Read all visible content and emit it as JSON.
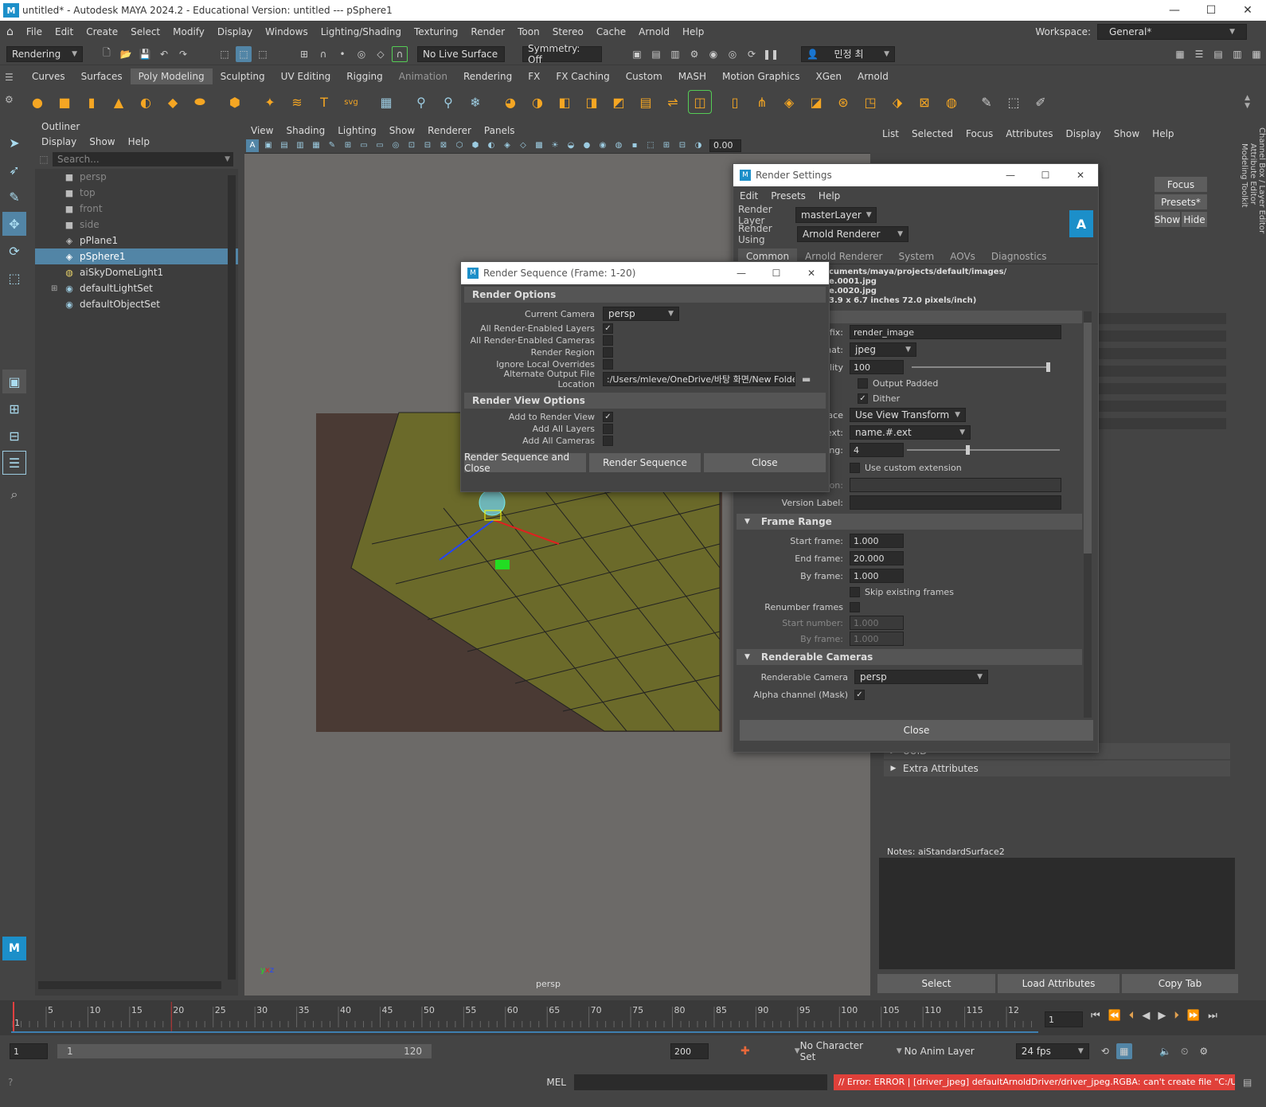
{
  "window": {
    "title": "untitled* - Autodesk MAYA 2024.2 - Educational Version: untitled   ---   pSphere1",
    "minimize": "—",
    "maximize": "☐",
    "close": "✕"
  },
  "menubar": {
    "items": [
      "File",
      "Edit",
      "Create",
      "Select",
      "Modify",
      "Display",
      "Windows",
      "Lighting/Shading",
      "Texturing",
      "Render",
      "Toon",
      "Stereo",
      "Cache",
      "Arnold",
      "Help"
    ],
    "workspace_label": "Workspace:",
    "workspace_value": "General*"
  },
  "statusline": {
    "menuset": "Rendering",
    "live_surface": "No Live Surface",
    "symmetry": "Symmetry: Off",
    "user": "민정 최"
  },
  "shelf": {
    "tabs": [
      "Curves",
      "Surfaces",
      "Poly Modeling",
      "Sculpting",
      "UV Editing",
      "Rigging",
      "Animation",
      "Rendering",
      "FX",
      "FX Caching",
      "Custom",
      "MASH",
      "Motion Graphics",
      "XGen",
      "Arnold"
    ],
    "active_tab": "Poly Modeling"
  },
  "outliner": {
    "title": "Outliner",
    "menu": [
      "Display",
      "Show",
      "Help"
    ],
    "search_placeholder": "Search...",
    "items": [
      {
        "label": "persp",
        "icon": "camera-icon",
        "state": "dim"
      },
      {
        "label": "top",
        "icon": "camera-icon",
        "state": "dim"
      },
      {
        "label": "front",
        "icon": "camera-icon",
        "state": "dim"
      },
      {
        "label": "side",
        "icon": "camera-icon",
        "state": "dim"
      },
      {
        "label": "pPlane1",
        "icon": "mesh-icon",
        "state": "normal"
      },
      {
        "label": "pSphere1",
        "icon": "mesh-icon",
        "state": "selected"
      },
      {
        "label": "aiSkyDomeLight1",
        "icon": "light-icon",
        "state": "normal"
      },
      {
        "label": "defaultLightSet",
        "icon": "set-icon",
        "state": "normal"
      },
      {
        "label": "defaultObjectSet",
        "icon": "set-icon",
        "state": "normal"
      }
    ]
  },
  "viewport": {
    "menu": [
      "View",
      "Shading",
      "Lighting",
      "Show",
      "Renderer",
      "Panels"
    ],
    "camera_label": "persp",
    "exposure": "0.00"
  },
  "attribute_editor": {
    "menu": [
      "List",
      "Selected",
      "Focus",
      "Attributes",
      "Display",
      "Show",
      "Help"
    ],
    "focus_button": "Focus",
    "presets_button": "Presets*",
    "show_button": "Show",
    "hide_button": "Hide",
    "uuid_section": "UUID",
    "extra_section": "Extra Attributes",
    "notes_label": "Notes:  aiStandardSurface2",
    "select_button": "Select",
    "load_button": "Load Attributes",
    "copy_button": "Copy Tab"
  },
  "render_settings": {
    "title": "Render Settings",
    "menu": [
      "Edit",
      "Presets",
      "Help"
    ],
    "render_layer_label": "Render Layer",
    "render_layer_value": "masterLayer",
    "render_using_label": "Render Using",
    "render_using_value": "Arnold Renderer",
    "tabs": [
      "Common",
      "Arnold Renderer",
      "System",
      "AOVs",
      "Diagnostics"
    ],
    "path_line1": "cuments/maya/projects/default/images/",
    "path_line2": "e.0001.jpg",
    "path_line3": "e.0020.jpg",
    "path_line4": "3.9 x 6.7 inches 72.0 pixels/inch)",
    "prefix_label": "prefix:",
    "prefix_value": "render_image",
    "format_label": "format:",
    "format_value": "jpeg",
    "quality_label": "Quality",
    "quality_value": "100",
    "output_padded": "Output Padded",
    "dither": "Dither",
    "space_label": "Space",
    "space_value": "Use View Transform",
    "ext_label": "on ext:",
    "ext_value": "name.#.ext",
    "padding_label": "dding:",
    "padding_value": "4",
    "custom_ext": "Use custom extension",
    "extension_label": "Extension:",
    "version_label": "Version Label:",
    "frame_range_section": "Frame Range",
    "start_frame_label": "Start frame:",
    "start_frame_value": "1.000",
    "end_frame_label": "End frame:",
    "end_frame_value": "20.000",
    "by_frame_label": "By frame:",
    "by_frame_value": "1.000",
    "skip_existing": "Skip existing frames",
    "renumber_label": "Renumber frames",
    "start_number_label": "Start number:",
    "start_number_value": "1.000",
    "by_frame2_label": "By frame:",
    "by_frame2_value": "1.000",
    "renderable_cameras_section": "Renderable Cameras",
    "renderable_camera_label": "Renderable Camera",
    "renderable_camera_value": "persp",
    "alpha_label": "Alpha channel (Mask)",
    "close_button": "Close"
  },
  "render_sequence": {
    "title": "Render Sequence (Frame: 1-20)",
    "render_options_section": "Render Options",
    "current_camera_label": "Current Camera",
    "current_camera_value": "persp",
    "all_layers_label": "All Render-Enabled Layers",
    "all_cameras_label": "All Render-Enabled Cameras",
    "render_region_label": "Render Region",
    "ignore_overrides_label": "Ignore Local Overrides",
    "alt_output_label": "Alternate Output File Location",
    "alt_output_value": ":/Users/mleve/OneDrive/바탕 화면/New Folder",
    "render_view_section": "Render View Options",
    "add_to_view_label": "Add to Render View",
    "add_layers_label": "Add All Layers",
    "add_cameras_label": "Add All Cameras",
    "btn_render_close": "Render Sequence and Close",
    "btn_render": "Render Sequence",
    "btn_close": "Close"
  },
  "timeline": {
    "ticks": [
      "1",
      "5",
      "10",
      "15",
      "20",
      "25",
      "30",
      "35",
      "40",
      "45",
      "50",
      "55",
      "60",
      "65",
      "70",
      "75",
      "80",
      "85",
      "90",
      "95",
      "100",
      "105",
      "110",
      "115",
      "12"
    ],
    "current_frame": "1"
  },
  "range": {
    "start": "1",
    "inner_start": "1",
    "inner_end": "120",
    "end": "200",
    "character_set": "No Character Set",
    "anim_layer": "No Anim Layer",
    "fps": "24 fps"
  },
  "cmdline": {
    "lang": "MEL",
    "error": "// Error: ERROR   |   [driver_jpeg] defaultArnoldDriver/driver_jpeg.RGBA: can't create file \"C:/Users/r"
  },
  "side_tabs": [
    "Channel Box / Layer Editor",
    "Attribute Editor",
    "Modeling Toolkit"
  ],
  "colors": {
    "accent": "#5285a6",
    "error": "#e0403a",
    "panel": "#444444"
  }
}
